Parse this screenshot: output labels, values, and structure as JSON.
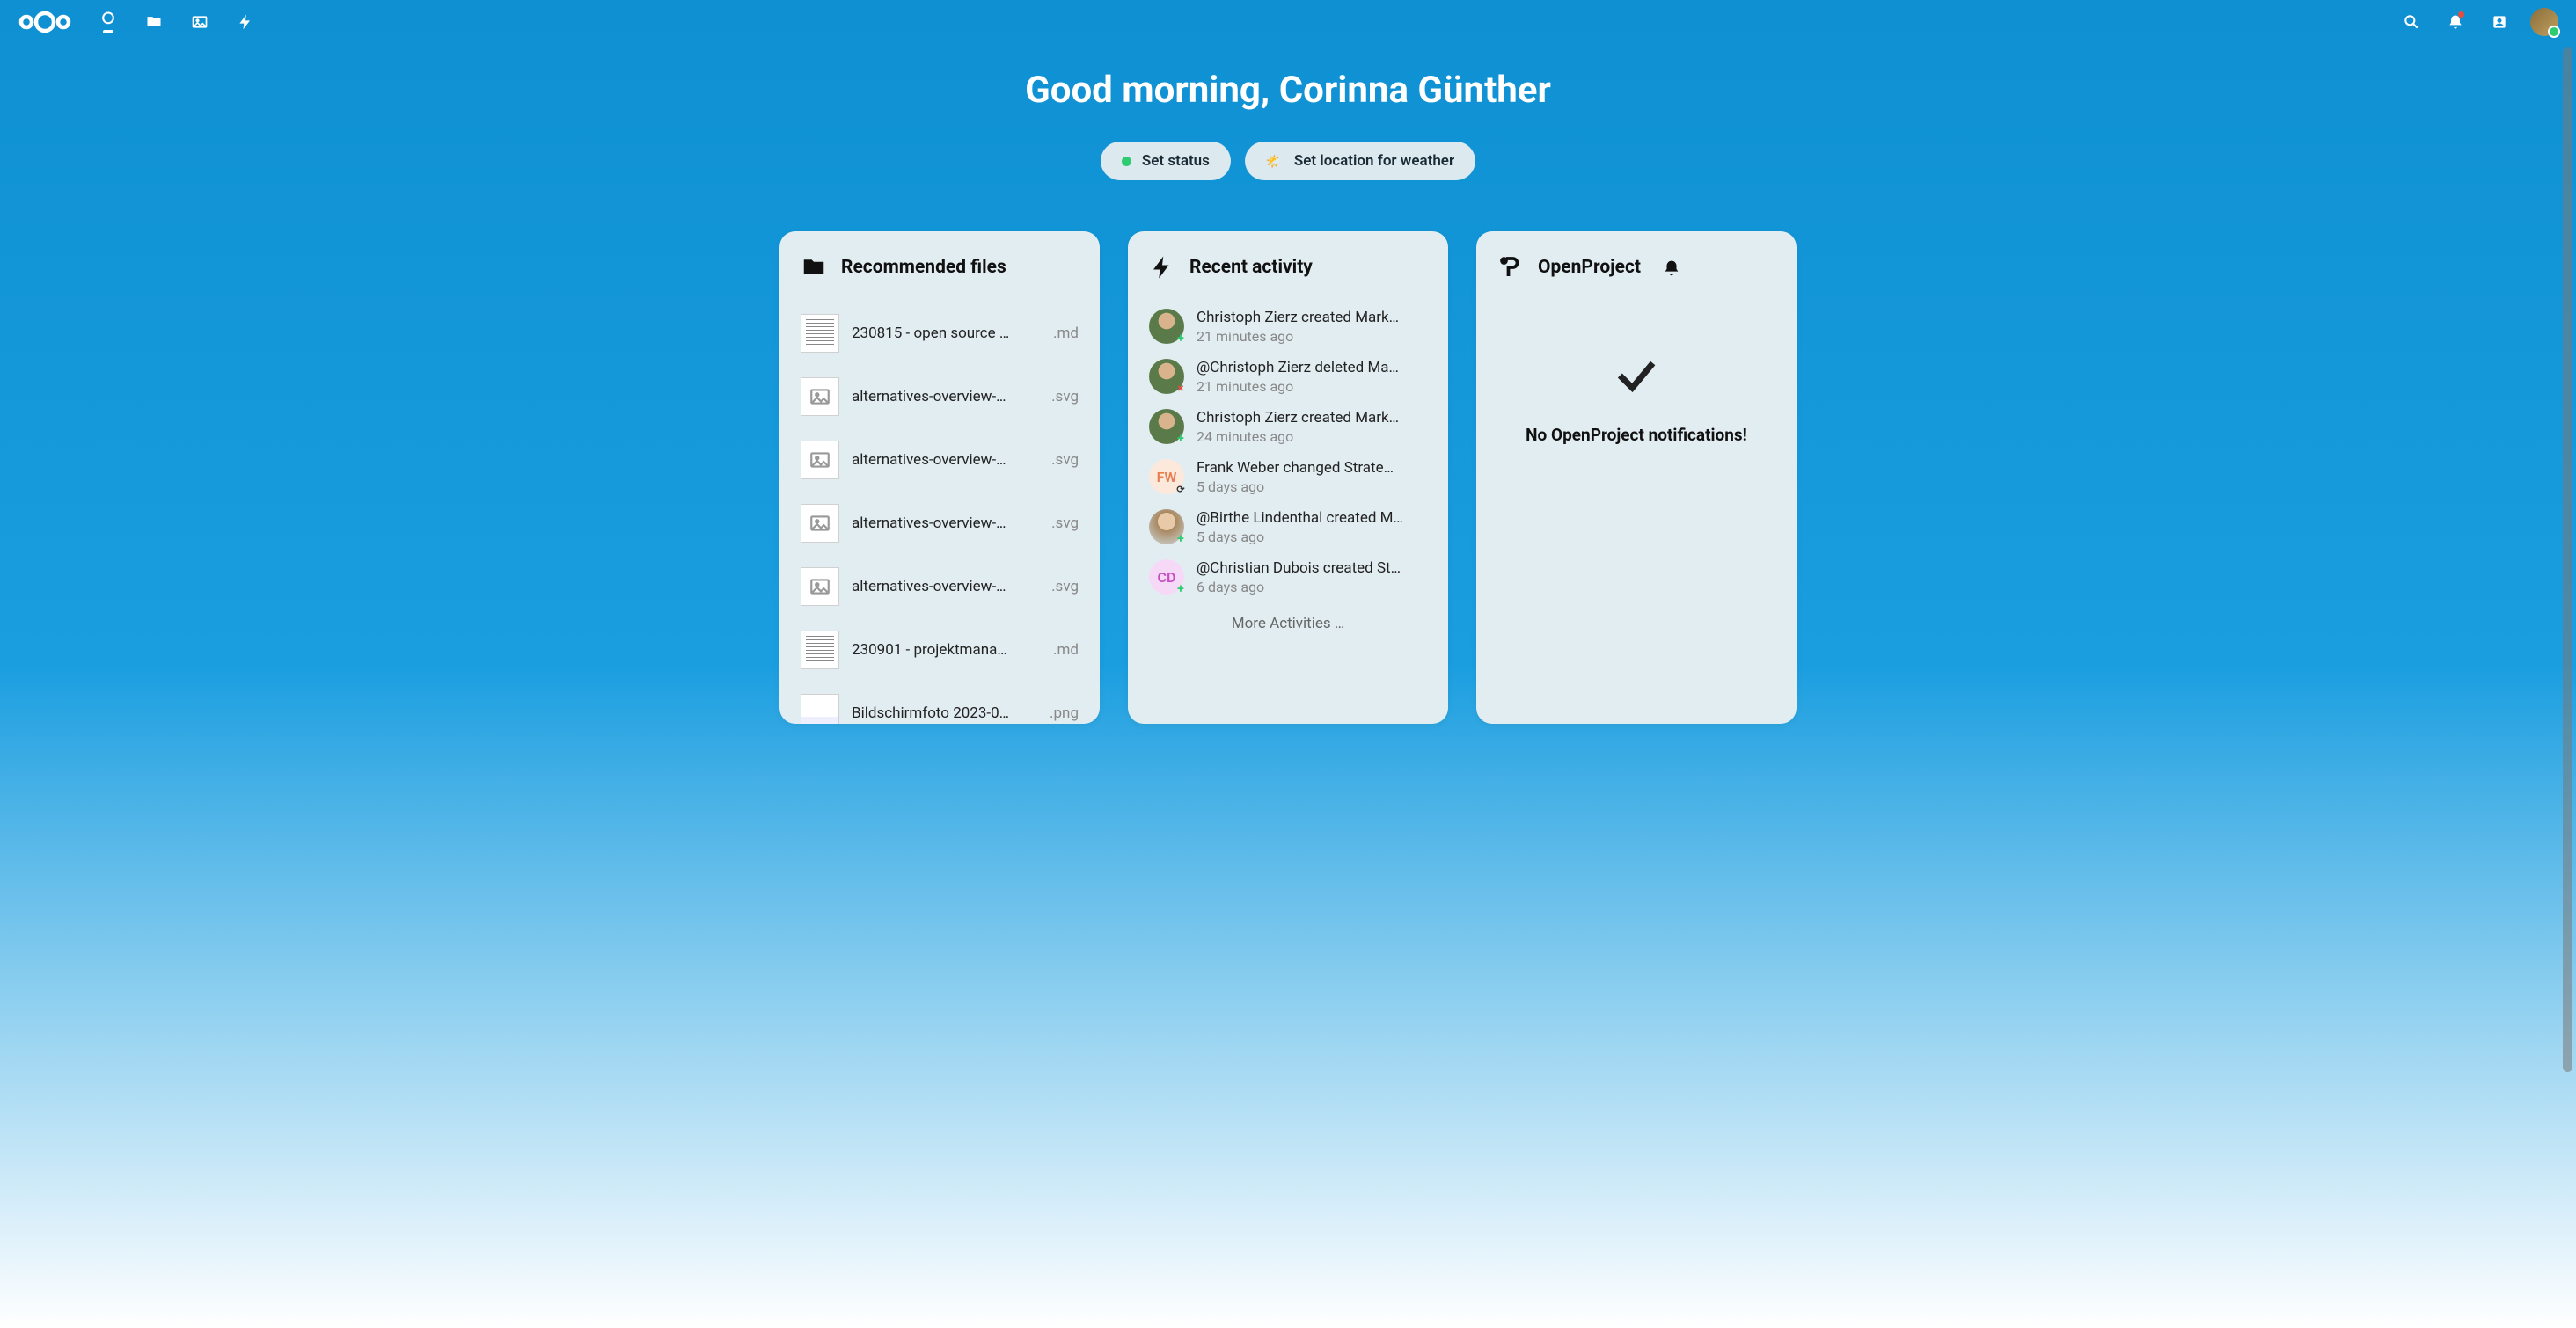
{
  "greeting": "Good morning, Corinna Günther",
  "status_button": {
    "label": "Set status"
  },
  "weather_button": {
    "label": "Set location for weather"
  },
  "widgets": {
    "recommended": {
      "title": "Recommended files",
      "files": [
        {
          "name": "230815 - open source …",
          "ext": ".md",
          "thumb": "doc"
        },
        {
          "name": "alternatives-overview-…",
          "ext": ".svg",
          "thumb": "img"
        },
        {
          "name": "alternatives-overview-…",
          "ext": ".svg",
          "thumb": "img"
        },
        {
          "name": "alternatives-overview-…",
          "ext": ".svg",
          "thumb": "img"
        },
        {
          "name": "alternatives-overview-…",
          "ext": ".svg",
          "thumb": "img"
        },
        {
          "name": "230901 - projektmana…",
          "ext": ".md",
          "thumb": "doc"
        },
        {
          "name": "Bildschirmfoto 2023-0…",
          "ext": ".png",
          "thumb": "shot"
        }
      ]
    },
    "activity": {
      "title": "Recent activity",
      "items": [
        {
          "avatar_type": "photo1",
          "text": "Christoph Zierz created Mark…",
          "time": "21 minutes ago",
          "badge": "plus"
        },
        {
          "avatar_type": "photo1",
          "text": "@Christoph Zierz deleted Ma…",
          "time": "21 minutes ago",
          "badge": "cross"
        },
        {
          "avatar_type": "photo1",
          "text": "Christoph Zierz created Mark…",
          "time": "24 minutes ago",
          "badge": "plus"
        },
        {
          "avatar_type": "initials",
          "initials": "FW",
          "color": "#e67e50",
          "bg": "#fde8dc",
          "text": "Frank Weber changed Strate…",
          "time": "5 days ago",
          "badge": "sync"
        },
        {
          "avatar_type": "photo2",
          "text": "@Birthe Lindenthal created M…",
          "time": "5 days ago",
          "badge": "plus"
        },
        {
          "avatar_type": "initials",
          "initials": "CD",
          "color": "#c44dc4",
          "bg": "#f6d9f6",
          "text": "@Christian Dubois created St…",
          "time": "6 days ago",
          "badge": "plus"
        }
      ],
      "more_label": "More Activities …"
    },
    "openproject": {
      "title": "OpenProject",
      "empty_text": "No OpenProject notifications!"
    }
  }
}
